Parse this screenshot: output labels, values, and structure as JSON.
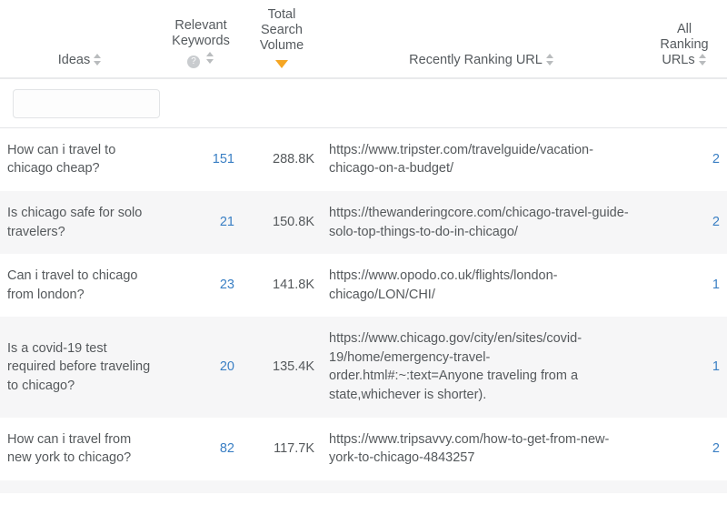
{
  "table": {
    "columns": [
      {
        "key": "ideas",
        "label": "Ideas",
        "sortable": true,
        "sort_state": "none"
      },
      {
        "key": "relkw",
        "label": "Relevant\nKeywords",
        "label_line1": "Relevant",
        "label_line2": "Keywords",
        "sortable": true,
        "has_help": true,
        "help_glyph": "?",
        "sort_state": "none"
      },
      {
        "key": "volume",
        "label_line1": "Total",
        "label_line2": "Search",
        "label_line3": "Volume",
        "sortable": true,
        "sort_state": "desc",
        "sort_color": "#f5a623"
      },
      {
        "key": "url",
        "label": "Recently Ranking URL",
        "sortable": true,
        "sort_state": "none"
      },
      {
        "key": "allurls",
        "label_line1": "All",
        "label_line2": "Ranking",
        "label_line3": "URLs",
        "sortable": true,
        "sort_state": "none"
      }
    ],
    "filter": {
      "value": "",
      "placeholder": ""
    },
    "rows": [
      {
        "idea": "How can i travel to chicago cheap?",
        "relevant_keywords": "151",
        "total_search_volume": "288.8K",
        "recently_ranking_url": "https://www.tripster.com/travelguide/vacation-chicago-on-a-budget/",
        "all_ranking_urls": "2"
      },
      {
        "idea": "Is chicago safe for solo travelers?",
        "relevant_keywords": "21",
        "total_search_volume": "150.8K",
        "recently_ranking_url": "https://thewanderingcore.com/chicago-travel-guide-solo-top-things-to-do-in-chicago/",
        "all_ranking_urls": "2"
      },
      {
        "idea": "Can i travel to chicago from london?",
        "relevant_keywords": "23",
        "total_search_volume": "141.8K",
        "recently_ranking_url": "https://www.opodo.co.uk/flights/london-chicago/LON/CHI/",
        "all_ranking_urls": "1"
      },
      {
        "idea": "Is a covid-19 test required before traveling to chicago?",
        "relevant_keywords": "20",
        "total_search_volume": "135.4K",
        "recently_ranking_url": "https://www.chicago.gov/city/en/sites/covid-19/home/emergency-travel-order.html#:~:text=Anyone traveling from a state,whichever is shorter).",
        "all_ranking_urls": "1"
      },
      {
        "idea": "How can i travel from new york to chicago?",
        "relevant_keywords": "82",
        "total_search_volume": "117.7K",
        "recently_ranking_url": "https://www.tripsavvy.com/how-to-get-from-new-york-to-chicago-4843257",
        "all_ranking_urls": "2"
      }
    ]
  },
  "colors": {
    "link": "#3a7fc4",
    "active_sort": "#f5a623",
    "url_text": "#b6b9bb",
    "body_text": "#55595c",
    "stripe": "#f6f6f7"
  }
}
